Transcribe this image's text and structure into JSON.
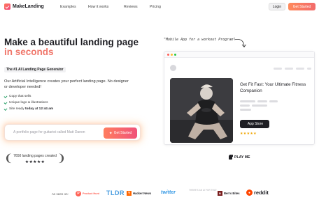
{
  "nav": {
    "logo_text": "MakeLanding",
    "links": [
      "Examples",
      "How it works",
      "Reviews",
      "Pricing"
    ],
    "login_label": "Login",
    "get_started_label": "Get Started"
  },
  "hero": {
    "title_line1": "Make a beautiful landing page",
    "title_line2": "in seconds",
    "badge": "The #1 AI Landing Page Generator",
    "description": "Our Artificial Intelligence creates your perfect landing page. No designer or developer needed!",
    "features": [
      {
        "text": "Copy that sells",
        "strong": ""
      },
      {
        "text": "Unique logo & illustrations",
        "strong": ""
      },
      {
        "text": "Site ready ",
        "strong": "today at 12:44 am"
      }
    ],
    "input_placeholder": "A portfolio page for guitarist called Matt Danon",
    "input_button": "Get Started",
    "counter_text": "7650 landing pages created",
    "counter_stars": "★★★★★"
  },
  "preview": {
    "annotation": "\"Mobile App for a workout Program\"",
    "card_title": "Get Fit Fast: Your Ultimate Fitness Companion",
    "store_button": "App Store",
    "stars": "★★★★★",
    "play_label": "PLAY ME"
  },
  "seen_on": {
    "label": "As seen on:",
    "brands": {
      "producthunt": "Product Hunt",
      "tldr": "TLDR",
      "hackernews": "Hacker News",
      "twitter": "twitter",
      "theresanai": "THERE'S AN AI FOR THAT",
      "bensbites": "Ben's Bites",
      "reddit": "reddit"
    }
  },
  "colors": {
    "accent": "#f0766a",
    "accent_gradient_start": "#ff7d5f",
    "accent_gradient_end": "#f0527a"
  }
}
